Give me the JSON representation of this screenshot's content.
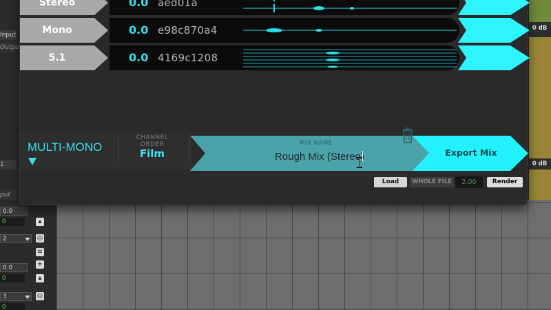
{
  "tracks_side": {
    "input_label": "Input",
    "output_label": "Output",
    "output_label_2": "put",
    "track_1_label": "1",
    "track_2_label": "2",
    "track_3_label": "3",
    "value_a": "0.0",
    "value_b": "0",
    "value_c": "0.0",
    "value_d": "0",
    "value_e": "0"
  },
  "right_meter": {
    "db_top": "0 dB",
    "db_bottom": "0 dB"
  },
  "rows": [
    {
      "label": "Stereo",
      "gain": "0.0",
      "hash": "aed01a"
    },
    {
      "label": "Mono",
      "gain": "0.0",
      "hash": "e98c870a4"
    },
    {
      "label": "5.1",
      "gain": "0.0",
      "hash": "4169c1208"
    }
  ],
  "format_mode": {
    "label": "MULTI-MONO"
  },
  "channel_order": {
    "label": "CHANNEL ORDER",
    "value": "Film"
  },
  "mix_name": {
    "label": "MIX NAME",
    "value": "Rough Mix (Stereo)"
  },
  "export": {
    "label": "Export Mix"
  },
  "footer": {
    "load": "Load",
    "whole_file": "WHOLE FILE",
    "whole_file_value": "2.00",
    "render": "Render"
  },
  "colors": {
    "accent": "#2ef4ff",
    "mix_panel": "#4aa3a9"
  }
}
